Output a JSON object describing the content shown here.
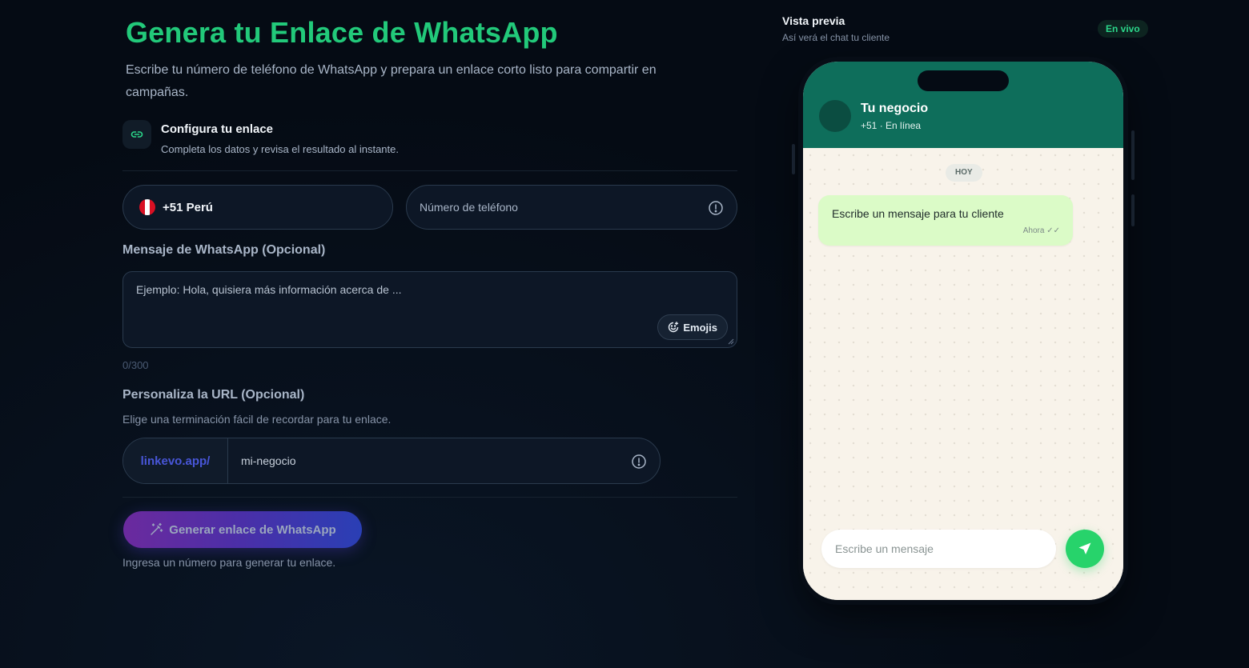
{
  "header": {
    "title": "Genera tu Enlace de WhatsApp",
    "subtitle": "Escribe tu número de teléfono de WhatsApp y prepara un enlace corto listo para compartir en campañas."
  },
  "config": {
    "icon": "link-icon",
    "title": "Configura tu enlace",
    "description": "Completa los datos y revisa el resultado al instante."
  },
  "country": {
    "label": "+51 Perú",
    "flag_colors": [
      "#d91023",
      "#ffffff",
      "#d91023"
    ]
  },
  "phone": {
    "placeholder": "Número de teléfono",
    "value": ""
  },
  "message": {
    "label": "Mensaje de WhatsApp (Opcional)",
    "placeholder": "Ejemplo: Hola, quisiera más información acerca de ...",
    "emoji_button": "Emojis",
    "counter": "0/300"
  },
  "url": {
    "label": "Personaliza la URL (Opcional)",
    "description": "Elige una terminación fácil de recordar para tu enlace.",
    "prefix": "linkevo.app/",
    "placeholder": "mi-negocio"
  },
  "generate": {
    "label": "Generar enlace de WhatsApp",
    "hint": "Ingresa un número para generar tu enlace."
  },
  "preview": {
    "title": "Vista previa",
    "subtitle": "Así verá el chat tu cliente",
    "badge": "En vivo",
    "chat": {
      "name": "Tu negocio",
      "status": "+51 · En línea",
      "day": "HOY",
      "bubble_text": "Escribe un mensaje para tu cliente",
      "bubble_time": "Ahora ✓✓",
      "composer_placeholder": "Escribe un mensaje"
    }
  },
  "colors": {
    "accent_green": "#22c97a",
    "chat_header": "#0e6e5b",
    "bubble": "#dbfbc7",
    "send_button": "#27d36b",
    "link_prefix": "#4856d8"
  }
}
